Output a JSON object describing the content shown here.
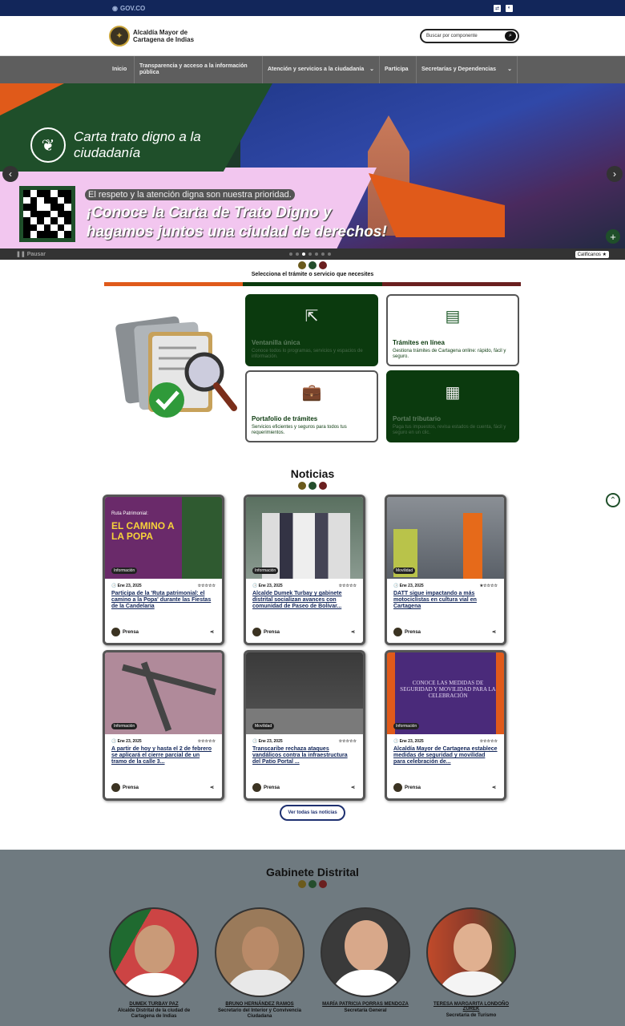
{
  "gov_bar": {
    "label": "GOV.CO"
  },
  "header": {
    "logo_line1": "Alcaldía Mayor de",
    "logo_line2": "Cartagena de Indias",
    "search_placeholder": "Buscar por componente"
  },
  "nav": {
    "items": [
      {
        "label": "Inicio"
      },
      {
        "label": "Transparencia y acceso a la información pública"
      },
      {
        "label": "Atención y servicios a la ciudadanía"
      },
      {
        "label": "Participa"
      },
      {
        "label": "Secretarías y Dependencias"
      }
    ]
  },
  "hero": {
    "title": "Carta trato digno a la ciudadanía",
    "tagline": "El respeto y la atención digna son nuestra prioridad.",
    "headline_1": "¡Conoce la Carta de Trato Digno y",
    "headline_2": "hagamos juntos una ciudad de derechos!",
    "pause_label": "Pausar",
    "rate_label": "Calificanos"
  },
  "services": {
    "subtitle": "Selecciona el trámite o servicio que necesites",
    "cards": [
      {
        "title": "Ventanilla única",
        "desc": "Conoce todos lo programas, servicios y espacios de información."
      },
      {
        "title": "Trámites en línea",
        "desc": "Gestiona trámites de Cartagena online: rápido, fácil y seguro."
      },
      {
        "title": "Portafolio de trámites",
        "desc": "Servicios eficientes y seguros para todos tus requerimientos."
      },
      {
        "title": "Portal tributario",
        "desc": "Paga tus impuestos, revisa estados de cuenta, fácil y seguro en un clic."
      }
    ]
  },
  "news": {
    "title": "Noticias",
    "see_all": "Ver todas las noticias",
    "items": [
      {
        "badge": "Información",
        "date": "Ene 23, 2025",
        "title": "Participa de la 'Ruta patrimonial: el camino a la Popa' durante las Fiestas de la Candelaria",
        "author": "Prensa",
        "img_text_1": "Ruta Patrimonial:",
        "img_text_2": "EL CAMINO A LA POPA"
      },
      {
        "badge": "Información",
        "date": "Ene 23, 2025",
        "title": "Alcalde Dumek Turbay y gabinete distrital socializan avances con comunidad de Paseo de Bolívar...",
        "author": "Prensa"
      },
      {
        "badge": "Movilidad",
        "date": "Ene 23, 2025",
        "title": "DATT sigue impactando a más motociclistas en cultura vial en Cartagena",
        "author": "Prensa"
      },
      {
        "badge": "Información",
        "date": "Ene 23, 2025",
        "title": "A partir de hoy y hasta el 2 de febrero se aplicará el cierre parcial de un tramo de la calle 3...",
        "author": "Prensa"
      },
      {
        "badge": "Movilidad",
        "date": "Ene 23, 2025",
        "title": "Transcaribe rechaza ataques vandálicos contra la infraestructura del Patio Portal ...",
        "author": "Prensa"
      },
      {
        "badge": "Información",
        "date": "Ene 23, 2025",
        "title": "Alcaldía Mayor de Cartagena establece medidas de seguridad y movilidad para celebración de...",
        "author": "Prensa",
        "img_text_1": "CONOCE LAS MEDIDAS DE SEGURIDAD Y MOVILIDAD PARA LA CELEBRACIÓN"
      }
    ]
  },
  "cabinet": {
    "title": "Gabinete Distrital",
    "people": [
      {
        "name": "DUMEK TURBAY PAZ",
        "role": "Alcalde Distrital de la ciudad de Cartagena de Indias"
      },
      {
        "name": "BRUNO HERNÁNDEZ RAMOS",
        "role": "Secretario del Interior y Convivencia Ciudadana"
      },
      {
        "name": "MARÍA PATRICIA PORRAS MENDOZA",
        "role": "Secretaría General"
      },
      {
        "name": "TERESA MARGARITA LONDOÑO ZUREK",
        "role": "Secretaría de Turismo"
      }
    ]
  },
  "colors": {
    "navy": "#12265a",
    "green": "#0b3a0e",
    "orange": "#e05a1a",
    "maroon": "#6a1f1f",
    "gold": "#6b5a1c"
  }
}
